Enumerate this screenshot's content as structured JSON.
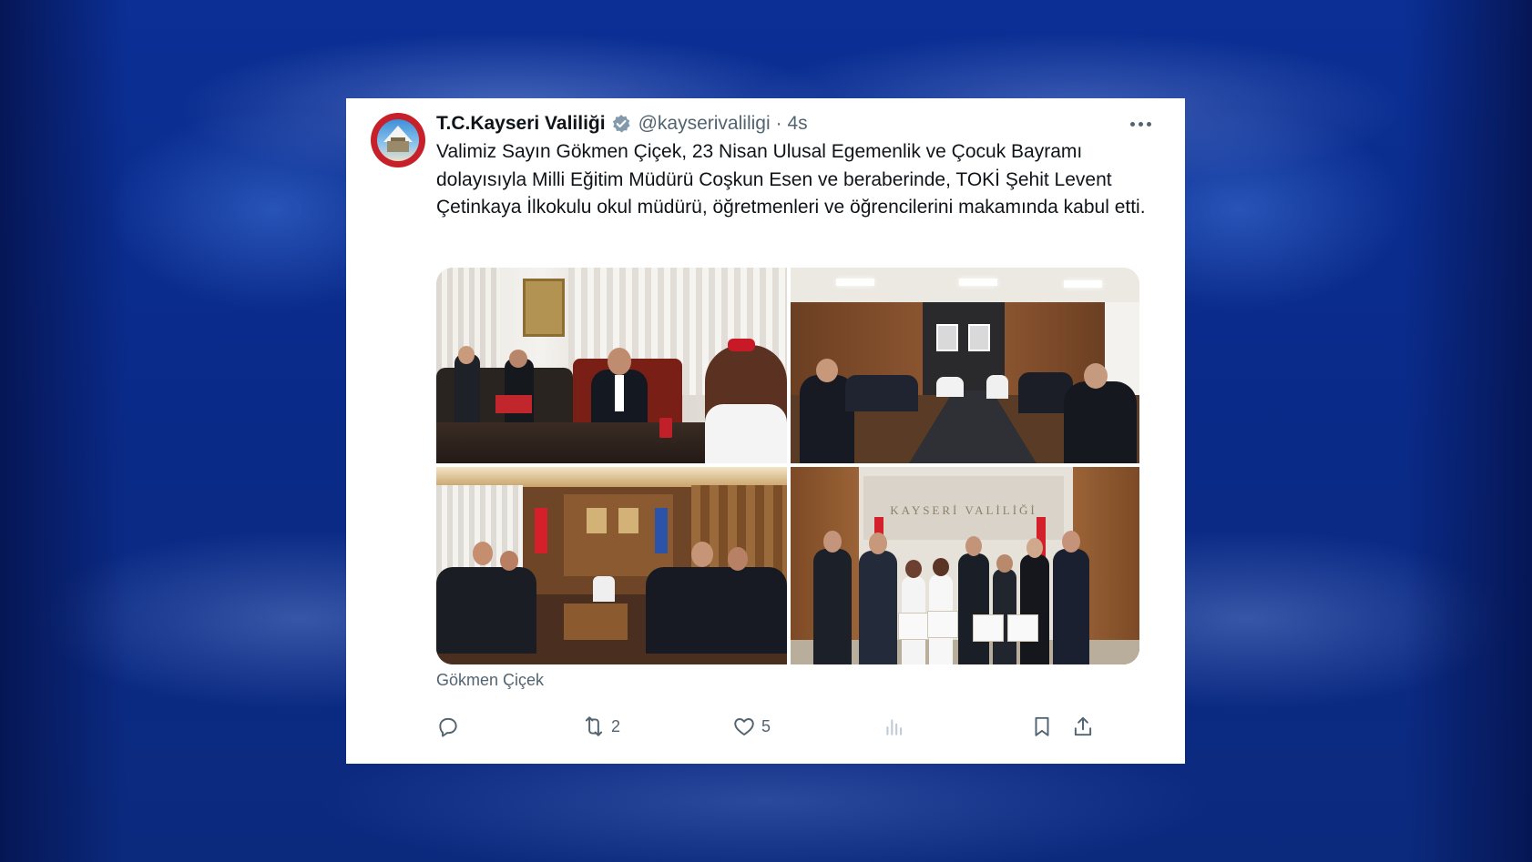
{
  "tweet": {
    "author_name": "T.C.Kayseri Valiliği",
    "handle": "@kayserivaliligi",
    "time": "· 4s",
    "text": "Valimiz Sayın Gökmen Çiçek, 23 Nisan Ulusal Egemenlik ve Çocuk Bayramı dolayısıyla Milli Eğitim Müdürü Coşkun Esen ve beraberinde, TOKİ Şehit Levent Çetinkaya İlkokulu okul müdürü, öğretmenleri ve öğrencilerini makamında kabul etti.",
    "media_caption": "Gökmen Çiçek",
    "wall_sign_text": "KAYSERİ VALİLİĞİ",
    "photos": [
      "office-meeting-photo",
      "conference-table-photo",
      "office-sofa-photo",
      "group-photo"
    ]
  },
  "actions": {
    "reply_count": "",
    "retweet_count": "2",
    "like_count": "5",
    "views_count": ""
  },
  "icons": [
    "reply-icon",
    "retweet-icon",
    "like-icon",
    "views-icon",
    "bookmark-icon",
    "share-icon",
    "more-icon",
    "verified-icon"
  ],
  "colors": {
    "background": "#0a2a8a",
    "card": "#ffffff",
    "text_primary": "#0f1419",
    "text_secondary": "#536471",
    "verified_badge": "#829aab"
  }
}
